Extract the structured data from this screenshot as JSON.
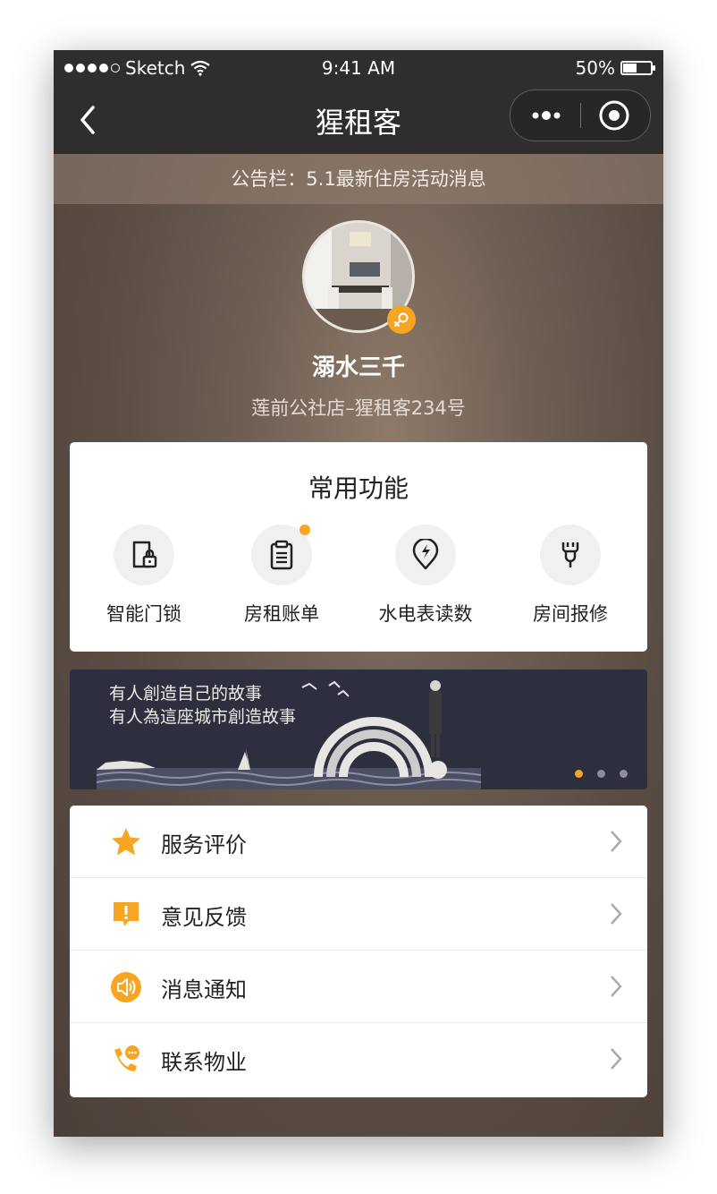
{
  "status_bar": {
    "carrier": "Sketch",
    "time": "9:41 AM",
    "battery": "50%",
    "battery_level": 0.5
  },
  "nav": {
    "title": "猩租客"
  },
  "notice": {
    "text": "公告栏：5.1最新住房活动消息"
  },
  "profile": {
    "name": "溺水三千",
    "store": "莲前公社店–猩租客234号"
  },
  "functions": {
    "title": "常用功能",
    "items": [
      {
        "label": "智能门锁",
        "icon": "door-lock-icon",
        "has_dot": false
      },
      {
        "label": "房租账单",
        "icon": "clipboard-icon",
        "has_dot": true
      },
      {
        "label": "水电表读数",
        "icon": "meter-icon",
        "has_dot": false
      },
      {
        "label": "房间报修",
        "icon": "wrench-icon",
        "has_dot": false
      }
    ]
  },
  "banner": {
    "line1": "有人創造自己的故事",
    "line2": "有人為這座城市創造故事",
    "slide_count": 3,
    "active_slide": 1
  },
  "menu": {
    "items": [
      {
        "label": "服务评价",
        "icon": "star-icon"
      },
      {
        "label": "意见反馈",
        "icon": "feedback-icon"
      },
      {
        "label": "消息通知",
        "icon": "speaker-icon"
      },
      {
        "label": "联系物业",
        "icon": "phone-chat-icon"
      }
    ]
  },
  "colors": {
    "accent": "#f6a623",
    "bar": "#2f2d2d",
    "banner": "#2e2f3e"
  }
}
